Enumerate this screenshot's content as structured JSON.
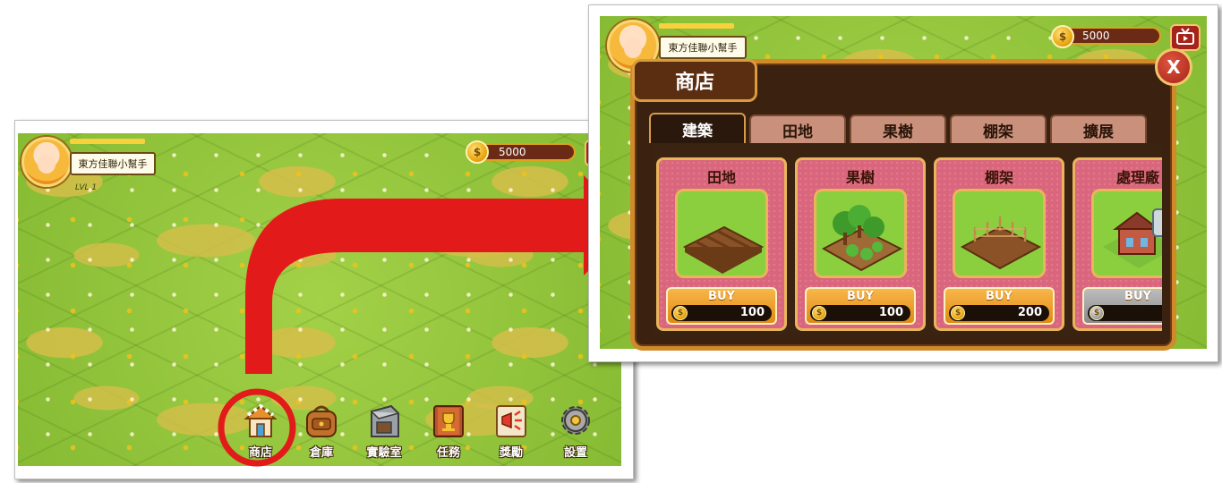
{
  "left_screen": {
    "player_name": "東方佳聯小幫手",
    "level": "LVL 1",
    "coins": "5000",
    "toolbar": [
      {
        "key": "shop",
        "label": "商店",
        "icon": "shop-icon"
      },
      {
        "key": "warehouse",
        "label": "倉庫",
        "icon": "bag-icon"
      },
      {
        "key": "lab",
        "label": "實驗室",
        "icon": "lab-icon"
      },
      {
        "key": "tasks",
        "label": "任務",
        "icon": "trophy-book-icon"
      },
      {
        "key": "rewards",
        "label": "獎勵",
        "icon": "megaphone-icon"
      },
      {
        "key": "settings",
        "label": "設置",
        "icon": "gear-icon"
      }
    ]
  },
  "right_screen": {
    "player_name": "東方佳聯小幫手",
    "coins": "5000",
    "shop_title": "商店",
    "close_icon": "X",
    "tabs": [
      "建築",
      "田地",
      "果樹",
      "棚架",
      "擴展"
    ],
    "active_tab": "建築",
    "items": [
      {
        "name": "田地",
        "buy_label": "BUY",
        "price": "100",
        "available": true,
        "icon": "field-icon"
      },
      {
        "name": "果樹",
        "buy_label": "BUY",
        "price": "100",
        "available": true,
        "icon": "fruit-tree-icon"
      },
      {
        "name": "棚架",
        "buy_label": "BUY",
        "price": "200",
        "available": true,
        "icon": "trellis-icon"
      },
      {
        "name": "處理廠",
        "buy_label": "BUY",
        "price": "",
        "available": false,
        "icon": "factory-icon"
      }
    ]
  },
  "colors": {
    "arrow": "#e21a1a",
    "highlight_circle": "#e21a1a",
    "coin": "#f2b01e",
    "shop_frame": "#d08a2a",
    "card": "#d9667c"
  }
}
